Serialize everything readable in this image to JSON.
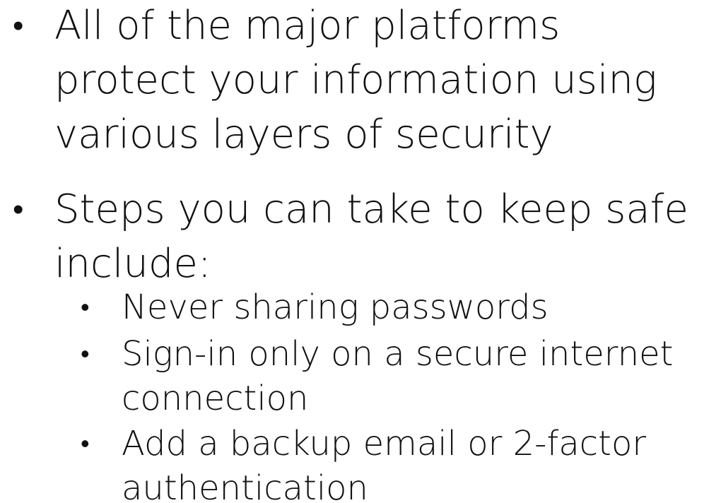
{
  "bullets": [
    {
      "text": "All of the major platforms\nprotect your information using\nvarious layers of security"
    },
    {
      "text": "Steps you can take to keep safe\ninclude:",
      "sub": [
        {
          "text": "Never sharing passwords"
        },
        {
          "text": "Sign-in only on a secure internet\nconnection"
        },
        {
          "text": "Add a backup email or 2-factor\nauthentication"
        }
      ]
    }
  ],
  "bullet_glyph": "•"
}
